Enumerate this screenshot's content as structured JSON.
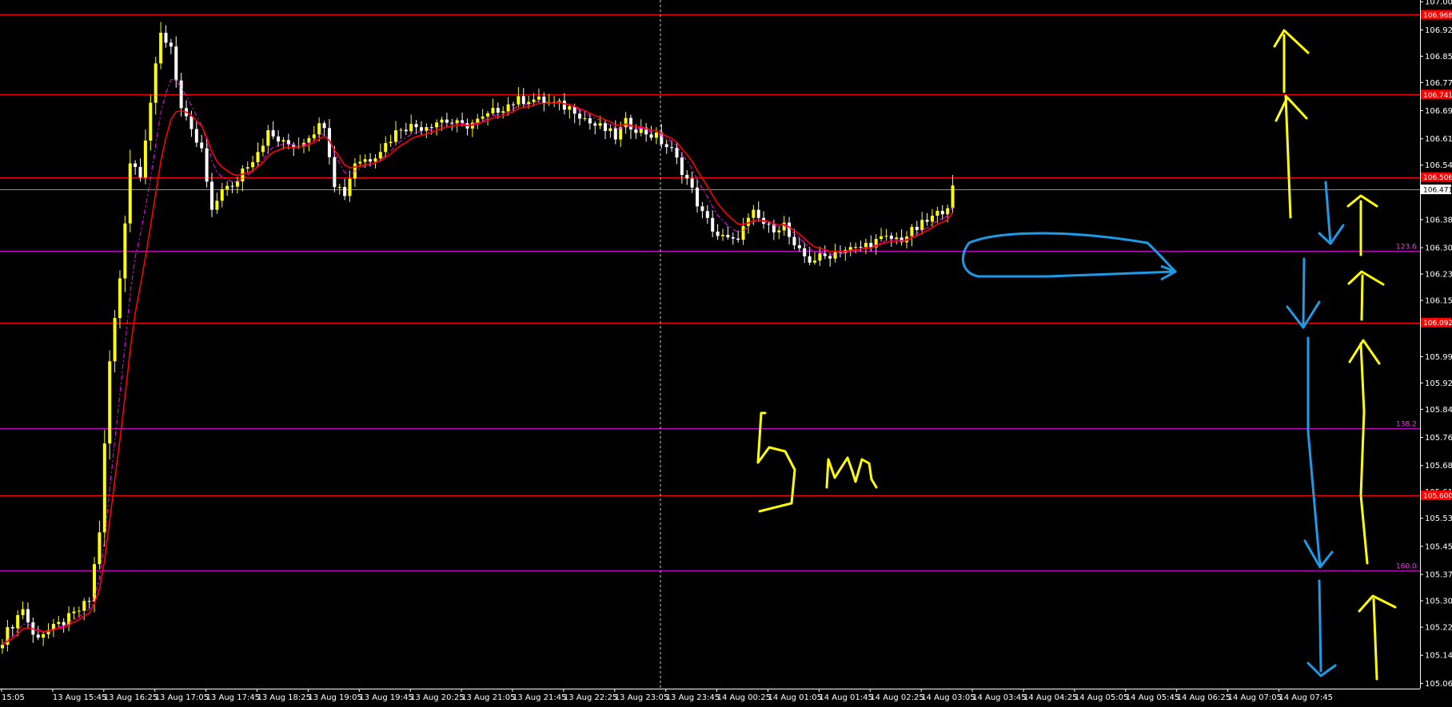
{
  "window": {
    "timeframe_annotation": "5m"
  },
  "colors": {
    "background": "#000000",
    "bull_candle": "#ffff00",
    "bear_candle": "#ffffff",
    "ma_fast": "#ff0000",
    "ma_slow": "#ff00ff",
    "hline_red": "#ff0000",
    "hline_fib": "#cc00cc",
    "annotation_yellow": "#ffff00",
    "annotation_blue": "#1e9be6",
    "crosshair": "#cccccc"
  },
  "price_axis": {
    "labels": [
      "107.005",
      "106.925",
      "106.850",
      "106.775",
      "106.695",
      "106.615",
      "106.540",
      "106.385",
      "106.305",
      "106.230",
      "106.155",
      "105.995",
      "105.920",
      "105.845",
      "105.765",
      "105.685",
      "105.610",
      "105.535",
      "105.455",
      "105.375",
      "105.300",
      "105.225",
      "105.145",
      "105.065"
    ],
    "current_price": "106.471"
  },
  "time_axis": {
    "labels": [
      "15:05",
      "13 Aug 15:45",
      "13 Aug 16:25",
      "13 Aug 17:05",
      "13 Aug 17:45",
      "13 Aug 18:25",
      "13 Aug 19:05",
      "13 Aug 19:45",
      "13 Aug 20:25",
      "13 Aug 21:05",
      "13 Aug 21:45",
      "13 Aug 22:25",
      "13 Aug 23:05",
      "13 Aug 23:45",
      "14 Aug 00:25",
      "14 Aug 01:05",
      "14 Aug 01:45",
      "14 Aug 02:25",
      "14 Aug 03:05",
      "14 Aug 03:45",
      "14 Aug 04:25",
      "14 Aug 05:05",
      "14 Aug 05:45",
      "14 Aug 06:25",
      "14 Aug 07:05",
      "14 Aug 07:45"
    ]
  },
  "chart_data": {
    "type": "candlestick",
    "ylim": [
      105.05,
      107.01
    ],
    "horizontal_levels": [
      {
        "price": 106.968,
        "label": "106.968",
        "kind": "red"
      },
      {
        "price": 106.741,
        "label": "106.741",
        "kind": "red"
      },
      {
        "price": 106.506,
        "label": "106.506",
        "kind": "red"
      },
      {
        "price": 106.092,
        "label": "106.092",
        "kind": "red"
      },
      {
        "price": 105.6,
        "label": "105.600",
        "kind": "red"
      },
      {
        "price": 106.471,
        "label": "",
        "kind": "current"
      },
      {
        "price": 106.296,
        "label": "123.6",
        "kind": "fib"
      },
      {
        "price": 105.792,
        "label": "138.2",
        "kind": "fib"
      },
      {
        "price": 105.387,
        "label": "160.0",
        "kind": "fib"
      }
    ],
    "anchors_close": [
      [
        0,
        105.19
      ],
      [
        4,
        105.28
      ],
      [
        6,
        105.2
      ],
      [
        10,
        105.22
      ],
      [
        14,
        105.26
      ],
      [
        17,
        105.3
      ],
      [
        19,
        105.5
      ],
      [
        21,
        105.98
      ],
      [
        23,
        106.22
      ],
      [
        25,
        106.55
      ],
      [
        27,
        106.52
      ],
      [
        29,
        106.72
      ],
      [
        31,
        106.91
      ],
      [
        33,
        106.88
      ],
      [
        35,
        106.7
      ],
      [
        37,
        106.63
      ],
      [
        39,
        106.58
      ],
      [
        41,
        106.4
      ],
      [
        43,
        106.48
      ],
      [
        45,
        106.47
      ],
      [
        47,
        106.53
      ],
      [
        49,
        106.56
      ],
      [
        52,
        106.63
      ],
      [
        55,
        106.6
      ],
      [
        58,
        106.6
      ],
      [
        61,
        106.64
      ],
      [
        63,
        106.66
      ],
      [
        65,
        106.49
      ],
      [
        67,
        106.46
      ],
      [
        69,
        106.55
      ],
      [
        72,
        106.56
      ],
      [
        75,
        106.6
      ],
      [
        78,
        106.65
      ],
      [
        82,
        106.65
      ],
      [
        86,
        106.67
      ],
      [
        90,
        106.65
      ],
      [
        94,
        106.67
      ],
      [
        97,
        106.7
      ],
      [
        100,
        106.72
      ],
      [
        103,
        106.73
      ],
      [
        106,
        106.72
      ],
      [
        109,
        106.71
      ],
      [
        112,
        106.7
      ],
      [
        115,
        106.66
      ],
      [
        118,
        106.64
      ],
      [
        120,
        106.62
      ],
      [
        122,
        106.66
      ],
      [
        125,
        106.64
      ],
      [
        128,
        106.62
      ],
      [
        131,
        106.58
      ],
      [
        134,
        106.5
      ],
      [
        137,
        106.4
      ],
      [
        140,
        106.34
      ],
      [
        143,
        106.32
      ],
      [
        145,
        106.36
      ],
      [
        147,
        106.4
      ],
      [
        150,
        106.36
      ],
      [
        153,
        106.37
      ],
      [
        155,
        106.3
      ],
      [
        158,
        106.27
      ],
      [
        161,
        106.28
      ],
      [
        164,
        106.3
      ],
      [
        167,
        106.3
      ],
      [
        170,
        106.32
      ],
      [
        173,
        106.33
      ],
      [
        176,
        106.33
      ],
      [
        179,
        106.36
      ],
      [
        183,
        106.4
      ],
      [
        185,
        106.43
      ],
      [
        186,
        106.47
      ]
    ],
    "annotations": [
      "5m"
    ]
  }
}
